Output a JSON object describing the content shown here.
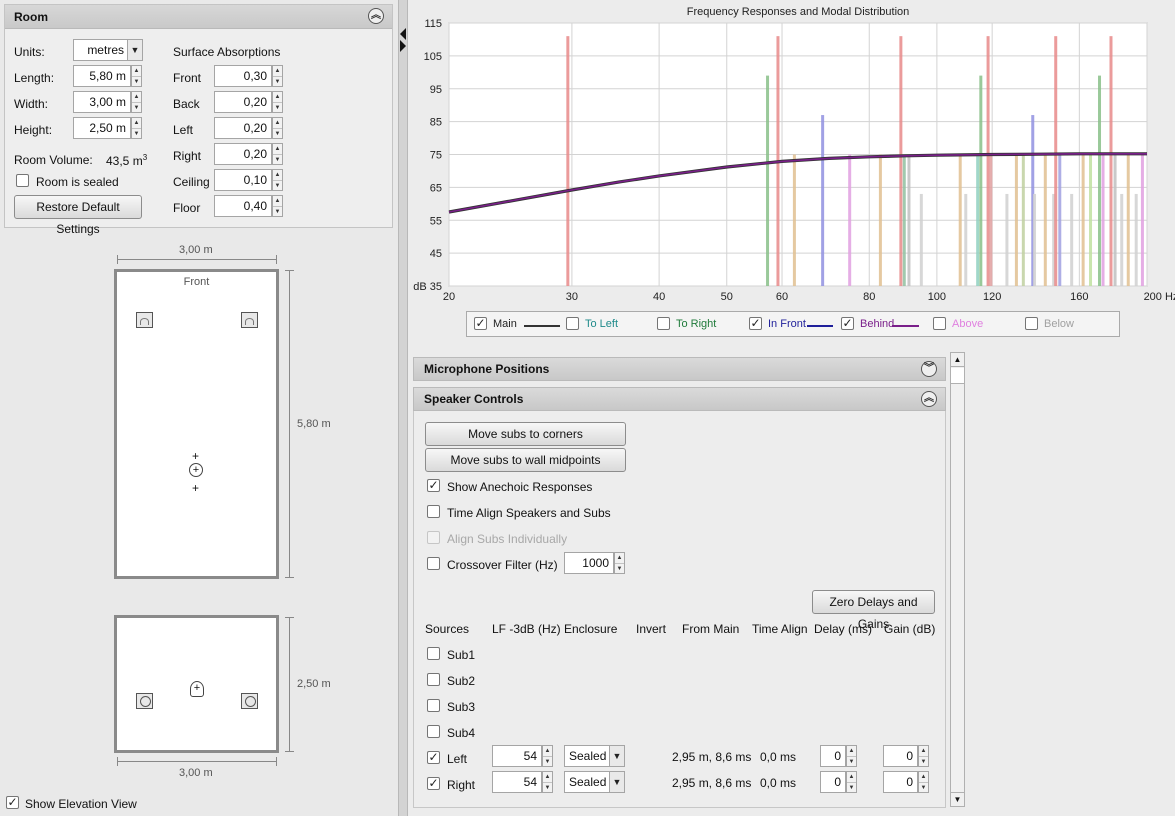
{
  "room": {
    "title": "Room",
    "units_label": "Units:",
    "units_value": "metres",
    "length_label": "Length:",
    "length_value": "5,80 m",
    "width_label": "Width:",
    "width_value": "3,00 m",
    "height_label": "Height:",
    "height_value": "2,50 m",
    "volume_label": "Room Volume:",
    "volume_value": "43,5 m",
    "volume_unit_sup": "3",
    "sealed_label": "Room is sealed",
    "sealed_checked": false,
    "restore_button": "Restore Default Settings",
    "absorptions_title": "Surface Absorptions",
    "absorptions": [
      {
        "label": "Front",
        "value": "0,30"
      },
      {
        "label": "Back",
        "value": "0,20"
      },
      {
        "label": "Left",
        "value": "0,20"
      },
      {
        "label": "Right",
        "value": "0,20"
      },
      {
        "label": "Ceiling",
        "value": "0,10"
      },
      {
        "label": "Floor",
        "value": "0,40"
      }
    ]
  },
  "plan": {
    "top_width": "3,00 m",
    "front_label": "Front",
    "length": "5,80 m",
    "elevation_height": "2,50 m",
    "bottom_width": "3,00 m",
    "show_elevation_label": "Show Elevation View",
    "show_elevation_checked": true
  },
  "chart_data": {
    "type": "line",
    "title": "Frequency Responses and Modal Distribution",
    "x_scale": "log",
    "xlim": [
      20,
      200
    ],
    "ylim": [
      35,
      115
    ],
    "x_ticks": [
      20,
      30,
      40,
      50,
      60,
      80,
      100,
      120,
      160,
      200
    ],
    "x_tick_labels": [
      "20",
      "30",
      "40",
      "50",
      "60",
      "80",
      "100",
      "120",
      "160",
      "200 Hz"
    ],
    "y_ticks": [
      35,
      45,
      55,
      65,
      75,
      85,
      95,
      105,
      115
    ],
    "y_tick_labels": [
      "dB 35",
      "45",
      "55",
      "65",
      "75",
      "85",
      "95",
      "105",
      "115"
    ],
    "grid": true,
    "series": [
      {
        "name": "Main",
        "color": "#333333",
        "x": [
          20,
          25,
          30,
          35,
          40,
          50,
          60,
          70,
          80,
          90,
          100,
          120,
          140,
          160,
          180,
          200
        ],
        "y": [
          57.5,
          61.2,
          64.2,
          66.6,
          68.5,
          71.2,
          72.9,
          73.8,
          74.3,
          74.6,
          74.8,
          75.0,
          75.1,
          75.2,
          75.2,
          75.2
        ]
      },
      {
        "name": "Behind",
        "color": "#7a1f8a",
        "x": [
          20,
          25,
          30,
          35,
          40,
          50,
          60,
          70,
          80,
          90,
          100,
          120,
          140,
          160,
          180,
          200
        ],
        "y": [
          57.5,
          61.2,
          64.2,
          66.6,
          68.5,
          71.2,
          72.9,
          73.8,
          74.3,
          74.6,
          74.8,
          75.0,
          75.1,
          75.2,
          75.2,
          75.2
        ]
      }
    ],
    "modes": [
      {
        "f": 29.6,
        "level": 111,
        "color": "#e88a8a"
      },
      {
        "f": 57.2,
        "level": 99,
        "color": "#88c088"
      },
      {
        "f": 59.2,
        "level": 111,
        "color": "#e88a8a"
      },
      {
        "f": 62.5,
        "level": 75,
        "color": "#e0c090"
      },
      {
        "f": 68.6,
        "level": 87,
        "color": "#9090e0"
      },
      {
        "f": 75.0,
        "level": 75,
        "color": "#e0a0e0"
      },
      {
        "f": 83.0,
        "level": 75,
        "color": "#e0c090"
      },
      {
        "f": 88.8,
        "level": 111,
        "color": "#e88a8a"
      },
      {
        "f": 89.8,
        "level": 75,
        "color": "#90c0a0"
      },
      {
        "f": 91.2,
        "level": 75,
        "color": "#c0c0c0"
      },
      {
        "f": 95.0,
        "level": 63,
        "color": "#d0d0d0"
      },
      {
        "f": 108.0,
        "level": 75,
        "color": "#e0c090"
      },
      {
        "f": 110.0,
        "level": 63,
        "color": "#d0d0d0"
      },
      {
        "f": 114.4,
        "level": 75,
        "color": "#90d0c0"
      },
      {
        "f": 115.6,
        "level": 99,
        "color": "#88c088"
      },
      {
        "f": 118.4,
        "level": 111,
        "color": "#e88a8a"
      },
      {
        "f": 119.5,
        "level": 75,
        "color": "#e0a0a0"
      },
      {
        "f": 126.0,
        "level": 63,
        "color": "#d0d0d0"
      },
      {
        "f": 130.0,
        "level": 75,
        "color": "#e0c090"
      },
      {
        "f": 133.0,
        "level": 75,
        "color": "#c0d0a0"
      },
      {
        "f": 137.2,
        "level": 87,
        "color": "#9090e0"
      },
      {
        "f": 138.0,
        "level": 63,
        "color": "#d0d0d0"
      },
      {
        "f": 143.0,
        "level": 75,
        "color": "#e0c090"
      },
      {
        "f": 147.0,
        "level": 63,
        "color": "#d0d0d0"
      },
      {
        "f": 148.0,
        "level": 111,
        "color": "#e88a8a"
      },
      {
        "f": 150.0,
        "level": 75,
        "color": "#a0a0e0"
      },
      {
        "f": 156.0,
        "level": 63,
        "color": "#d0d0d0"
      },
      {
        "f": 162.0,
        "level": 75,
        "color": "#e0c090"
      },
      {
        "f": 166.0,
        "level": 75,
        "color": "#c0e0a0"
      },
      {
        "f": 171.0,
        "level": 99,
        "color": "#88c088"
      },
      {
        "f": 173.0,
        "level": 75,
        "color": "#e0a0e0"
      },
      {
        "f": 177.6,
        "level": 111,
        "color": "#e88a8a"
      },
      {
        "f": 180.0,
        "level": 75,
        "color": "#c0c0c0"
      },
      {
        "f": 184.0,
        "level": 63,
        "color": "#d0d0d0"
      },
      {
        "f": 188.0,
        "level": 75,
        "color": "#e0c090"
      },
      {
        "f": 193.0,
        "level": 63,
        "color": "#d0d0d0"
      },
      {
        "f": 197.0,
        "level": 75,
        "color": "#e0a0e0"
      }
    ]
  },
  "legend": [
    {
      "label": "Main",
      "checked": true,
      "color": "#333333",
      "line": true
    },
    {
      "label": "To Left",
      "checked": false,
      "color": "#1f8a8a",
      "line": false
    },
    {
      "label": "To Right",
      "checked": false,
      "color": "#1f7a3a",
      "line": false
    },
    {
      "label": "In Front",
      "checked": true,
      "color": "#1f1f9a",
      "line": true
    },
    {
      "label": "Behind",
      "checked": true,
      "color": "#7a1f8a",
      "line": true
    },
    {
      "label": "Above",
      "checked": false,
      "color": "#e080e0",
      "line": false
    },
    {
      "label": "Below",
      "checked": false,
      "color": "#a0a0a0",
      "line": false
    }
  ],
  "mic_section": {
    "title": "Microphone Positions"
  },
  "speaker_section": {
    "title": "Speaker Controls",
    "move_corners": "Move subs to corners",
    "move_midpoints": "Move subs to wall midpoints",
    "show_anechoic": "Show Anechoic Responses",
    "show_anechoic_checked": true,
    "time_align": "Time Align Speakers and Subs",
    "align_subs": "Align Subs Individually",
    "crossover": "Crossover Filter (Hz)",
    "crossover_value": "1000",
    "zero_button": "Zero Delays and Gains",
    "columns": [
      "Sources",
      "LF -3dB (Hz)",
      "Enclosure",
      "Invert",
      "From Main",
      "Time Align",
      "Delay (ms)",
      "Gain (dB)"
    ],
    "subs": [
      "Sub1",
      "Sub2",
      "Sub3",
      "Sub4"
    ],
    "speakers": [
      {
        "name": "Left",
        "checked": true,
        "lf": "54",
        "enclosure": "Sealed",
        "from_main": "2,95 m, 8,6 ms",
        "time_align": "0,0 ms",
        "delay": "0",
        "gain": "0"
      },
      {
        "name": "Right",
        "checked": true,
        "lf": "54",
        "enclosure": "Sealed",
        "from_main": "2,95 m, 8,6 ms",
        "time_align": "0,0 ms",
        "delay": "0",
        "gain": "0"
      }
    ]
  }
}
